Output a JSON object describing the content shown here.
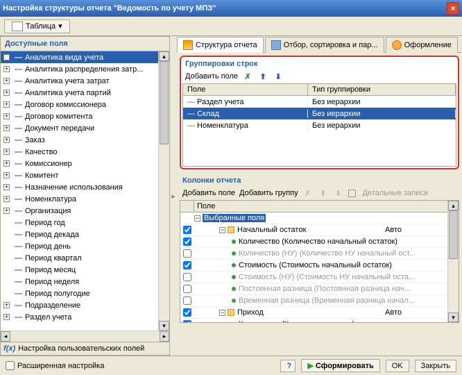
{
  "title": "Настройка структуры отчета \"Ведомость по учету МПЗ\"",
  "toolbar": {
    "table_label": "Таблица"
  },
  "left": {
    "title": "Доступные поля",
    "items": [
      {
        "label": "Аналитика вида учета",
        "sel": true
      },
      {
        "label": "Аналитика распределения затр..."
      },
      {
        "label": "Аналитика учета затрат"
      },
      {
        "label": "Аналитика учета партий"
      },
      {
        "label": "Договор комиссионера"
      },
      {
        "label": "Договор комитента"
      },
      {
        "label": "Документ передачи"
      },
      {
        "label": "Заказ"
      },
      {
        "label": "Качество"
      },
      {
        "label": "Комиссионер"
      },
      {
        "label": "Комитент"
      },
      {
        "label": "Назначение использования"
      },
      {
        "label": "Номенклатура"
      },
      {
        "label": "Организация"
      },
      {
        "label": "Период год",
        "leaf": true
      },
      {
        "label": "Период декада",
        "leaf": true
      },
      {
        "label": "Период день",
        "leaf": true
      },
      {
        "label": "Период квартал",
        "leaf": true
      },
      {
        "label": "Период месяц",
        "leaf": true
      },
      {
        "label": "Период неделя",
        "leaf": true
      },
      {
        "label": "Период полугодие",
        "leaf": true
      },
      {
        "label": "Подразделение"
      },
      {
        "label": "Раздел учета"
      }
    ],
    "footer": "Настройка пользовательских полей"
  },
  "tabs": {
    "struct": "Структура отчета",
    "filter": "Отбор, сортировка и пар...",
    "design": "Оформление"
  },
  "groupings": {
    "title": "Группировки строк",
    "add": "Добавить поле",
    "col_field": "Поле",
    "col_type": "Тип группировки",
    "rows": [
      {
        "field": "Раздел учета",
        "type": "Без иерархии"
      },
      {
        "field": "Склад",
        "type": "Без иерархии",
        "sel": true
      },
      {
        "field": "Номенклатура",
        "type": "Без иерархии"
      }
    ]
  },
  "columns": {
    "title": "Колонки отчета",
    "add_field": "Добавить поле",
    "add_group": "Добавить группу",
    "detail": "Детальные записи",
    "head": "Поле",
    "selected": "Выбранные поля",
    "rows": [
      {
        "chk": true,
        "indent": 2,
        "kind": "group",
        "label": "Начальный остаток",
        "auto": "Авто"
      },
      {
        "chk": true,
        "indent": 3,
        "kind": "field",
        "label": "Количество (Количество начальный остаток)"
      },
      {
        "chk": false,
        "indent": 3,
        "kind": "field",
        "gray": true,
        "label": "Количество (НУ) (Количество НУ начальный ост..."
      },
      {
        "chk": true,
        "indent": 3,
        "kind": "field",
        "label": "Стоимость (Стоимость начальный остаток)"
      },
      {
        "chk": false,
        "indent": 3,
        "kind": "field",
        "gray": true,
        "label": "Стоимость (НУ) (Стоимость НУ начальный оста..."
      },
      {
        "chk": false,
        "indent": 3,
        "kind": "field",
        "gray": true,
        "label": "Постоянная разница (Постоянная разница нач..."
      },
      {
        "chk": false,
        "indent": 3,
        "kind": "field",
        "gray": true,
        "label": "Временная разница (Временная разница начал..."
      },
      {
        "chk": true,
        "indent": 2,
        "kind": "group",
        "label": "Приход",
        "auto": "Авто"
      },
      {
        "chk": true,
        "indent": 3,
        "kind": "field",
        "label": "Количество (Количество приход)"
      }
    ]
  },
  "bottom": {
    "advanced": "Расширенная настройка",
    "form": "Сформировать",
    "ok": "OK",
    "close": "Закрыть"
  }
}
